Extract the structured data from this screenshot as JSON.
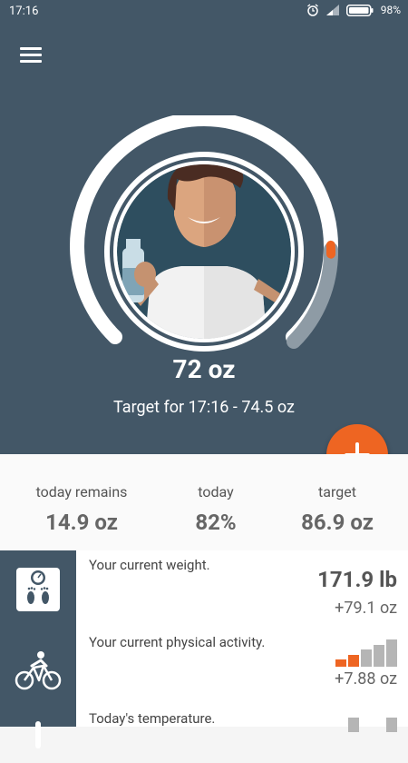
{
  "status_bar": {
    "time": "17:16",
    "battery": "98%"
  },
  "hero": {
    "amount": "72 oz",
    "target_text": "Target for 17:16 - 74.5 oz",
    "progress_fraction": 0.83
  },
  "stats": [
    {
      "label": "today remains",
      "value": "14.9 oz"
    },
    {
      "label": "today",
      "value": "82%"
    },
    {
      "label": "target",
      "value": "86.9 oz"
    }
  ],
  "rows": [
    {
      "title": "Your current weight.",
      "value": "171.9 lb",
      "delta": "+79.1 oz"
    },
    {
      "title": "Your current physical activity.",
      "delta": "+7.88 oz",
      "activity_levels": [
        "orange",
        "orange",
        "gray",
        "gray",
        "gray"
      ]
    },
    {
      "title": "Today's temperature."
    }
  ],
  "colors": {
    "background": "#435767",
    "accent": "#ee6522",
    "inactive_bar": "#b5b5b5"
  },
  "icons": [
    "menu-icon",
    "alarm-icon",
    "signal-icon",
    "battery-icon",
    "add-icon",
    "scale-icon",
    "cycling-icon",
    "thermometer-icon"
  ]
}
